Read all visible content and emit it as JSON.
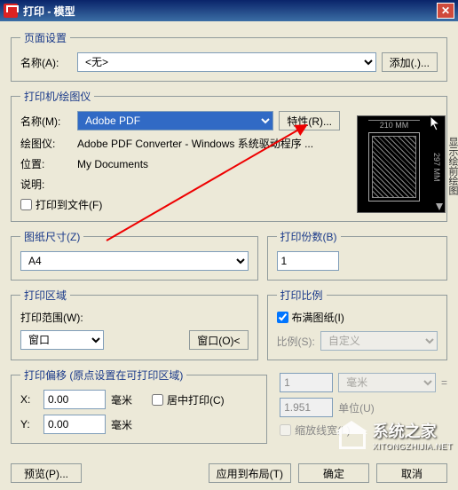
{
  "window": {
    "title": "打印 - 模型",
    "close": "✕"
  },
  "page_setup": {
    "legend": "页面设置",
    "name_label": "名称(A):",
    "name_value": "<无>",
    "add_btn": "添加(.)..."
  },
  "printer": {
    "legend": "打印机/绘图仪",
    "name_label": "名称(M):",
    "name_value": "Adobe PDF",
    "props_btn": "特性(R)...",
    "plotter_label": "绘图仪:",
    "plotter_value": "Adobe PDF Converter - Windows 系统驱动程序 ...",
    "location_label": "位置:",
    "location_value": "My Documents",
    "desc_label": "说明:",
    "desc_value": "",
    "to_file": "打印到文件(F)",
    "preview_width": "210 MM",
    "preview_height": "297 MM",
    "hint": "显示绘前绘图"
  },
  "paper": {
    "legend": "图纸尺寸(Z)",
    "value": "A4"
  },
  "copies": {
    "legend": "打印份数(B)",
    "value": "1"
  },
  "area": {
    "legend": "打印区域",
    "range_label": "打印范围(W):",
    "range_value": "窗口",
    "window_btn": "窗口(O)<"
  },
  "scale": {
    "legend": "打印比例",
    "fit": "布满图纸(I)",
    "scale_label": "比例(S):",
    "scale_value": "自定义",
    "num": "1",
    "unit": "毫米",
    "equals": "=",
    "denom": "1.951",
    "denom_unit": "单位(U)",
    "lineweight": "缩放线宽(L)"
  },
  "offset": {
    "legend": "打印偏移 (原点设置在可打印区域)",
    "x_label": "X:",
    "x_value": "0.00",
    "y_label": "Y:",
    "y_value": "0.00",
    "unit": "毫米",
    "center": "居中打印(C)"
  },
  "buttons": {
    "preview": "预览(P)...",
    "apply": "应用到布局(T)",
    "ok": "确定",
    "cancel": "取消"
  },
  "watermark": {
    "name": "系统之家",
    "url": "XITONGZHIJIA.NET"
  }
}
